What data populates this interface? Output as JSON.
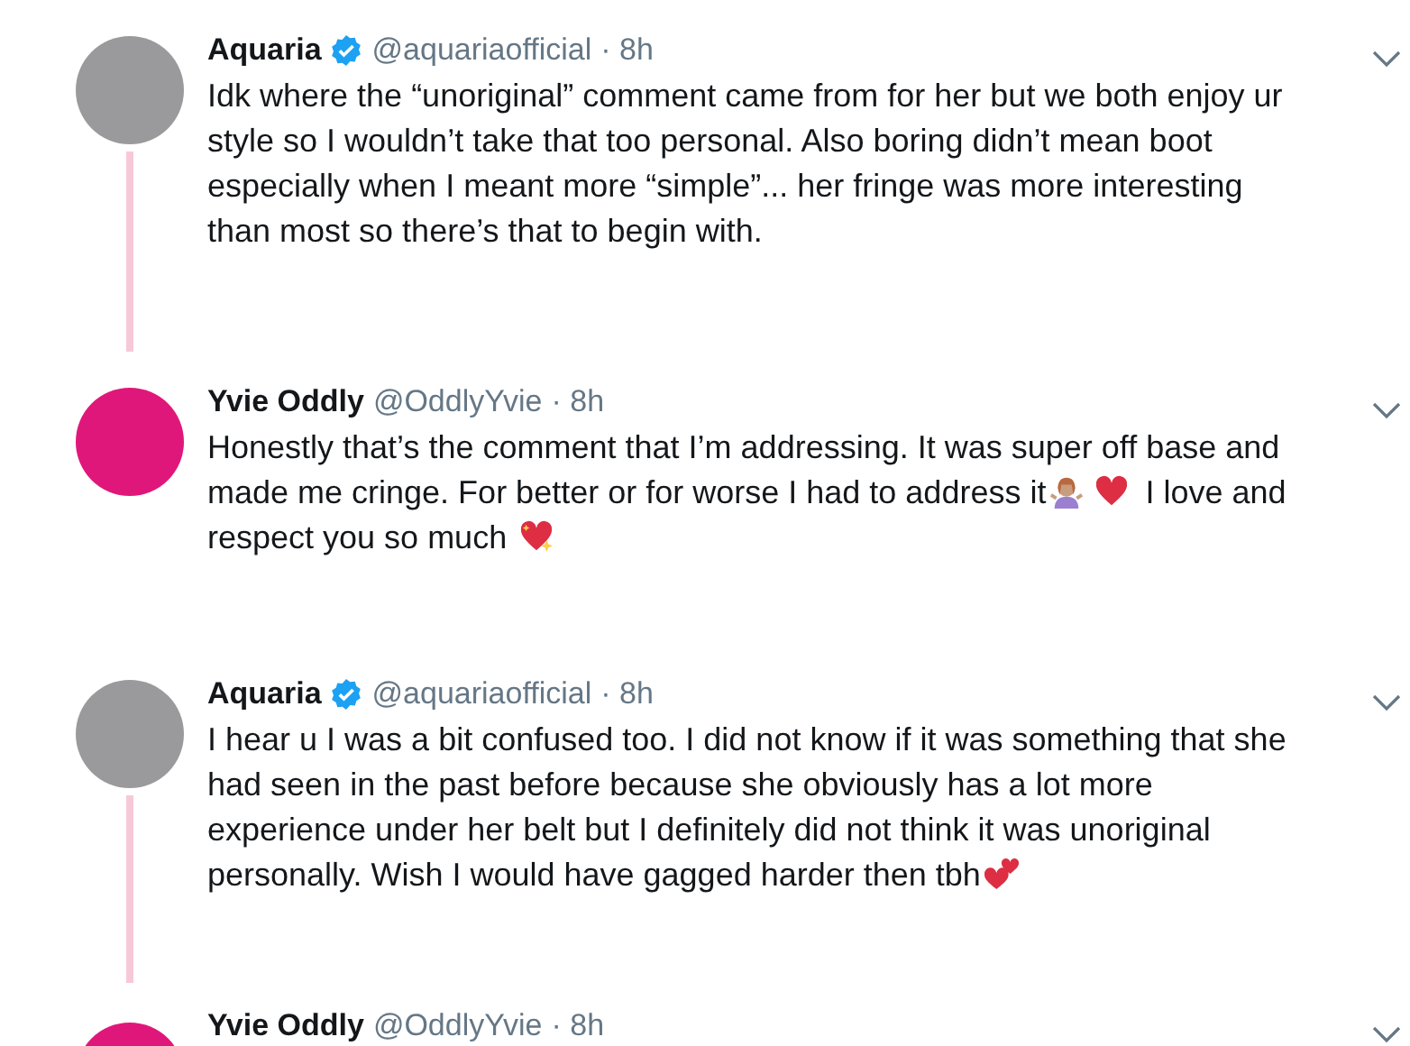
{
  "tweets": [
    {
      "author": "Aquaria",
      "verified": true,
      "handle": "@aquariaofficial",
      "time": "· 8h",
      "color": "#9a9a9c",
      "connected_below": true,
      "body": [
        {
          "kind": "text",
          "text": "Idk where the “unoriginal” comment came from for her but we both enjoy ur style so I wouldn’t take that too personal. Also boring didn’t mean boot especially when I meant more “simple”... her fringe was more interesting than most so there’s that to begin with."
        }
      ]
    },
    {
      "author": "Yvie Oddly",
      "verified": false,
      "handle": "@OddlyYvie",
      "time": "· 8h",
      "color": "#e0177a",
      "connected_below": false,
      "body": [
        {
          "kind": "text",
          "text": "Honestly that’s the comment that I’m addressing. It was super off base and made me cringe. For better or for worse I had to address it"
        },
        {
          "kind": "shrug"
        },
        {
          "kind": "heart"
        },
        {
          "kind": "text",
          "text": " I love and respect you so much "
        },
        {
          "kind": "sparkling-heart"
        }
      ]
    },
    {
      "author": "Aquaria",
      "verified": true,
      "handle": "@aquariaofficial",
      "time": "· 8h",
      "color": "#9a9a9c",
      "connected_below": true,
      "body": [
        {
          "kind": "text",
          "text": "I hear u I was a bit confused too. I did not know if it was something that she had seen in the past before because she obviously has a lot more experience under her belt but I definitely did not think it was unoriginal personally. Wish I would have gagged harder then tbh"
        },
        {
          "kind": "two-hearts"
        }
      ]
    },
    {
      "author": "Yvie Oddly",
      "verified": false,
      "handle": "@OddlyYvie",
      "time": "· 8h",
      "color": "#e0177a",
      "connected_below": false
    }
  ]
}
